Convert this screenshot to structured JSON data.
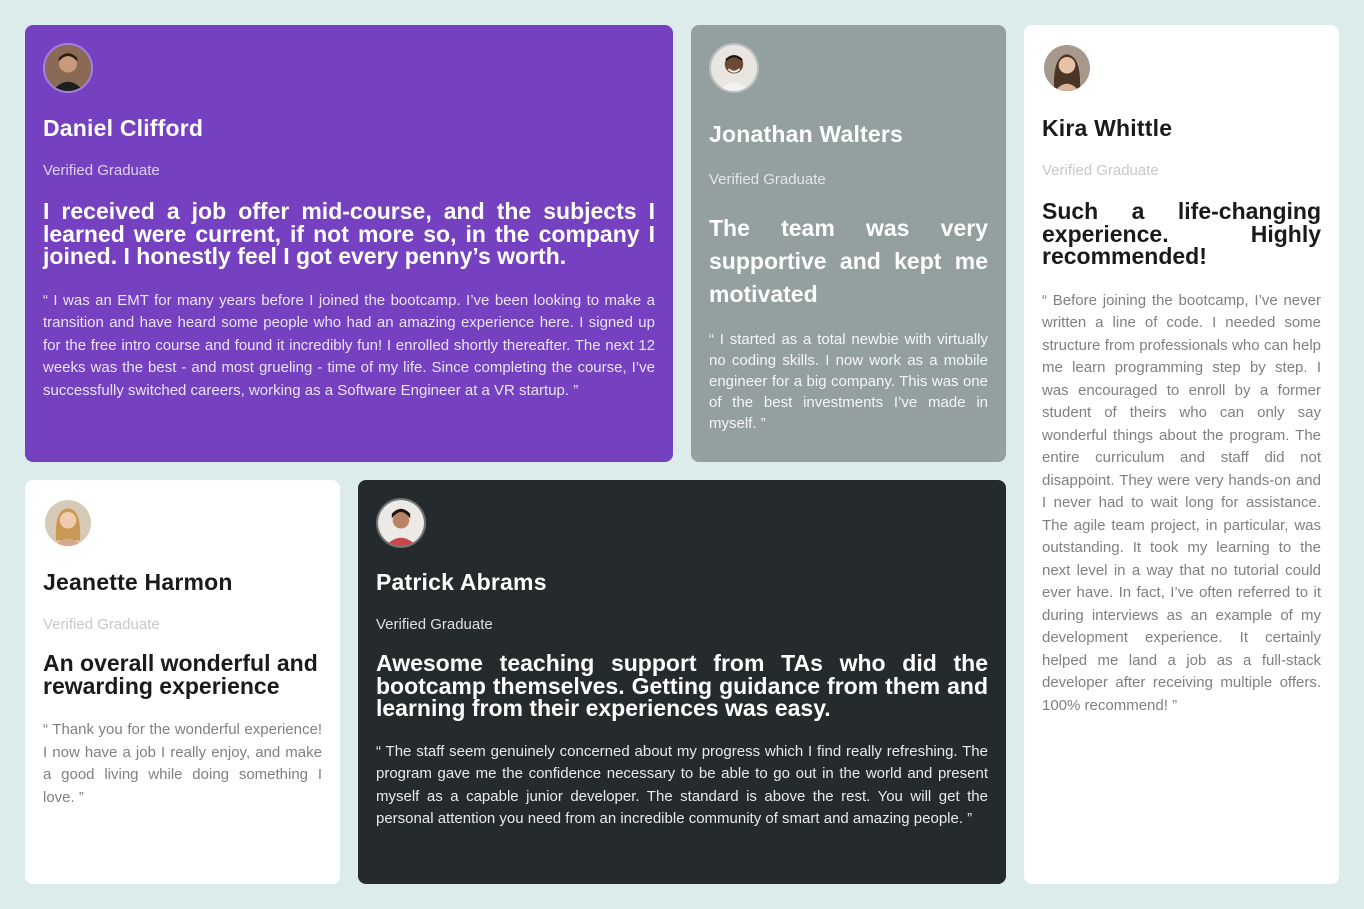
{
  "testimonials": {
    "daniel": {
      "name": "Daniel Clifford",
      "role": "Verified Graduate",
      "headline": "I received a job offer mid-course, and the subjects I learned were current, if not more so, in the company I joined. I honestly feel I got every penny’s worth.",
      "quote": "“ I was an EMT for many years before I joined the bootcamp. I’ve been looking to make a transition and have heard some people who had an amazing experience here. I signed up for the free intro course and found it incredibly fun! I enrolled shortly thereafter. The next 12 weeks was the best - and most grueling - time of my life. Since completing the course, I’ve successfully switched careers, working as a Software Engineer at a VR startup. ”",
      "avatar_icon": "avatar-daniel",
      "background": "#7541c1"
    },
    "jonathan": {
      "name": "Jonathan Walters",
      "role": "Verified Graduate",
      "headline": "The team was very supportive and kept me motivated",
      "quote": "“ I started as a total newbie with virtually no coding skills. I now work as a mobile engineer for a big company. This was one of the best investments I’ve made in myself. ”",
      "avatar_icon": "avatar-jonathan",
      "background": "#949fa0"
    },
    "kira": {
      "name": "Kira Whittle",
      "role": "Verified Graduate",
      "headline": "Such a life-changing experience. Highly recommended!",
      "quote": "“ Before joining the bootcamp, I’ve never written a line of code. I needed some structure from professionals who can help me learn programming step by step. I was encouraged to enroll by a former student of theirs who can only say wonderful things about the program. The entire curriculum and staff did not disappoint. They were very hands-on and I never had to wait long for assistance. The agile team project, in particular, was outstanding. It took my learning to the next level in a way that no tutorial could ever have. In fact, I’ve often referred to it during interviews as an example of my development experience. It certainly helped me land a job as a full-stack developer after receiving multiple offers. 100% recommend! ”",
      "avatar_icon": "avatar-kira",
      "background": "#ffffff"
    },
    "jeanette": {
      "name": "Jeanette Harmon",
      "role": "Verified Graduate",
      "headline": "An overall wonderful and rewarding experience",
      "quote": "“ Thank you for the wonderful experience! I now have a job I really enjoy, and make a good living while doing something I love. ”",
      "avatar_icon": "avatar-jeanette",
      "background": "#ffffff"
    },
    "patrick": {
      "name": "Patrick Abrams",
      "role": "Verified Graduate",
      "headline": "Awesome teaching support from TAs who did the bootcamp themselves. Getting guidance from them and learning from their experiences was easy.",
      "quote": "“ The staff seem genuinely concerned about my progress which I find really refreshing. The program gave me the confidence necessary to be able to go out in the world and present myself as a capable junior developer. The standard is above the rest. You will get the personal attention you need from an incredible community of smart and amazing people. ”",
      "avatar_icon": "avatar-patrick",
      "background": "#252a2c"
    }
  }
}
